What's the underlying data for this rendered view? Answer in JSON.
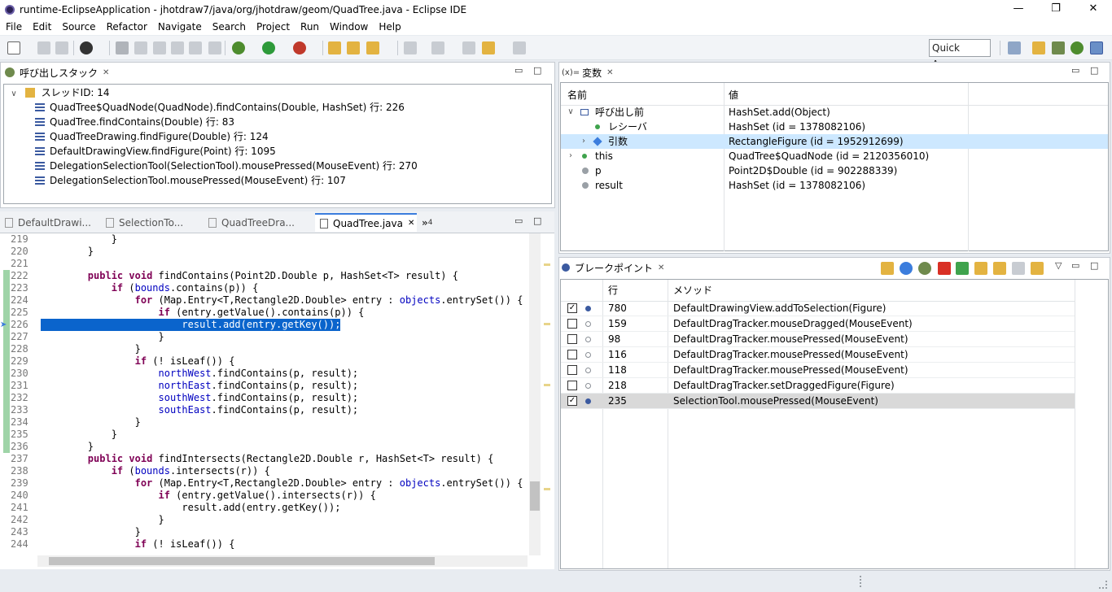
{
  "window": {
    "title": "runtime-EclipseApplication - jhotdraw7/java/org/jhotdraw/geom/QuadTree.java - Eclipse IDE",
    "minimize": "—",
    "restore": "❐",
    "close": "✕"
  },
  "menu": [
    "File",
    "Edit",
    "Source",
    "Refactor",
    "Navigate",
    "Search",
    "Project",
    "Run",
    "Window",
    "Help"
  ],
  "toolbar": {
    "quick_access": "Quick Access"
  },
  "callstack": {
    "tab": "呼び出しスタック",
    "thread": "スレッドID: 14",
    "frames": [
      "QuadTree$QuadNode(QuadNode).findContains(Double, HashSet) 行: 226",
      "QuadTree.findContains(Double) 行: 83",
      "QuadTreeDrawing.findFigure(Double) 行: 124",
      "DefaultDrawingView.findFigure(Point) 行: 1095",
      "DelegationSelectionTool(SelectionTool).mousePressed(MouseEvent) 行: 270",
      "DelegationSelectionTool.mousePressed(MouseEvent) 行: 107"
    ]
  },
  "editor": {
    "tabs": [
      "DefaultDrawi...",
      "SelectionTo...",
      "QuadTreeDra...",
      "QuadTree.java"
    ],
    "overflow": "4",
    "lines": [
      {
        "n": "219",
        "t": "            }"
      },
      {
        "n": "220",
        "t": "        }"
      },
      {
        "n": "221",
        "t": ""
      },
      {
        "n": "222",
        "t": "        public void findContains(Point2D.Double p, HashSet<T> result) {"
      },
      {
        "n": "223",
        "t": "            if (bounds.contains(p)) {"
      },
      {
        "n": "224",
        "t": "                for (Map.Entry<T,Rectangle2D.Double> entry : objects.entrySet()) {"
      },
      {
        "n": "225",
        "t": "                    if (entry.getValue().contains(p)) {"
      },
      {
        "n": "226",
        "t": "                        result.add(entry.getKey());"
      },
      {
        "n": "227",
        "t": "                    }"
      },
      {
        "n": "228",
        "t": "                }"
      },
      {
        "n": "229",
        "t": "                if (! isLeaf()) {"
      },
      {
        "n": "230",
        "t": "                    northWest.findContains(p, result);"
      },
      {
        "n": "231",
        "t": "                    northEast.findContains(p, result);"
      },
      {
        "n": "232",
        "t": "                    southWest.findContains(p, result);"
      },
      {
        "n": "233",
        "t": "                    southEast.findContains(p, result);"
      },
      {
        "n": "234",
        "t": "                }"
      },
      {
        "n": "235",
        "t": "            }"
      },
      {
        "n": "236",
        "t": "        }"
      },
      {
        "n": "237",
        "t": "        public void findIntersects(Rectangle2D.Double r, HashSet<T> result) {"
      },
      {
        "n": "238",
        "t": "            if (bounds.intersects(r)) {"
      },
      {
        "n": "239",
        "t": "                for (Map.Entry<T,Rectangle2D.Double> entry : objects.entrySet()) {"
      },
      {
        "n": "240",
        "t": "                    if (entry.getValue().intersects(r)) {"
      },
      {
        "n": "241",
        "t": "                        result.add(entry.getKey());"
      },
      {
        "n": "242",
        "t": "                    }"
      },
      {
        "n": "243",
        "t": "                }"
      },
      {
        "n": "244",
        "t": "                if (! isLeaf()) {"
      }
    ]
  },
  "variables": {
    "tab": "変数",
    "tab_prefix": "(x)=",
    "col_name": "名前",
    "col_value": "値",
    "rows": [
      {
        "name": "呼び出し前",
        "value": "HashSet.add(Object)"
      },
      {
        "name": "レシーバ",
        "value": "HashSet (id = 1378082106)"
      },
      {
        "name": "引数",
        "value": "RectangleFigure (id = 1952912699)"
      },
      {
        "name": "this",
        "value": "QuadTree$QuadNode (id = 2120356010)"
      },
      {
        "name": "p",
        "value": "Point2D$Double (id = 902288339)"
      },
      {
        "name": "result",
        "value": "HashSet (id = 1378082106)"
      }
    ]
  },
  "breakpoints": {
    "tab": "ブレークポイント",
    "col_line": "行",
    "col_method": "メソッド",
    "rows": [
      {
        "checked": "✓",
        "line": "780",
        "method": "DefaultDrawingView.addToSelection(Figure)"
      },
      {
        "checked": "",
        "line": "159",
        "method": "DefaultDragTracker.mouseDragged(MouseEvent)"
      },
      {
        "checked": "",
        "line": "98",
        "method": "DefaultDragTracker.mousePressed(MouseEvent)"
      },
      {
        "checked": "",
        "line": "116",
        "method": "DefaultDragTracker.mousePressed(MouseEvent)"
      },
      {
        "checked": "",
        "line": "118",
        "method": "DefaultDragTracker.mousePressed(MouseEvent)"
      },
      {
        "checked": "",
        "line": "218",
        "method": "DefaultDragTracker.setDraggedFigure(Figure)"
      },
      {
        "checked": "✓",
        "line": "235",
        "method": "SelectionTool.mousePressed(MouseEvent)"
      }
    ]
  },
  "colors": {
    "accent": "#0a64cc",
    "keyword": "#7f0055",
    "field": "#0000c0",
    "selection_row": "#cde8ff"
  }
}
